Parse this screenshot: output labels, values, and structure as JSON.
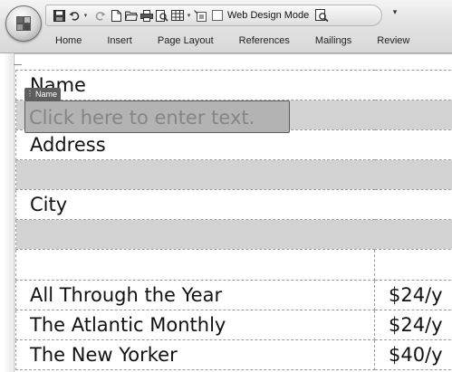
{
  "ribbon": {
    "office_button": "office-button",
    "qat": {
      "web_design_mode_label": "Web Design Mode",
      "web_design_mode_checked": false
    },
    "tabs": [
      "Home",
      "Insert",
      "Page Layout",
      "References",
      "Mailings",
      "Review"
    ]
  },
  "document": {
    "content_control": {
      "tag": "Name",
      "placeholder": "Click here to enter text."
    },
    "rows": [
      {
        "label": "Name",
        "shaded": false
      },
      {
        "label": "",
        "shaded": true
      },
      {
        "label": "Address",
        "shaded": false
      },
      {
        "label": "",
        "shaded": true
      },
      {
        "label": "City",
        "shaded": false
      },
      {
        "label": "",
        "shaded": true
      }
    ],
    "subscriptions": [
      {
        "name": "",
        "price": ""
      },
      {
        "name": "All Through the Year",
        "price": "$24/y"
      },
      {
        "name": "The Atlantic Monthly",
        "price": "$24/y"
      },
      {
        "name": "The New Yorker",
        "price": "$40/y"
      }
    ]
  }
}
